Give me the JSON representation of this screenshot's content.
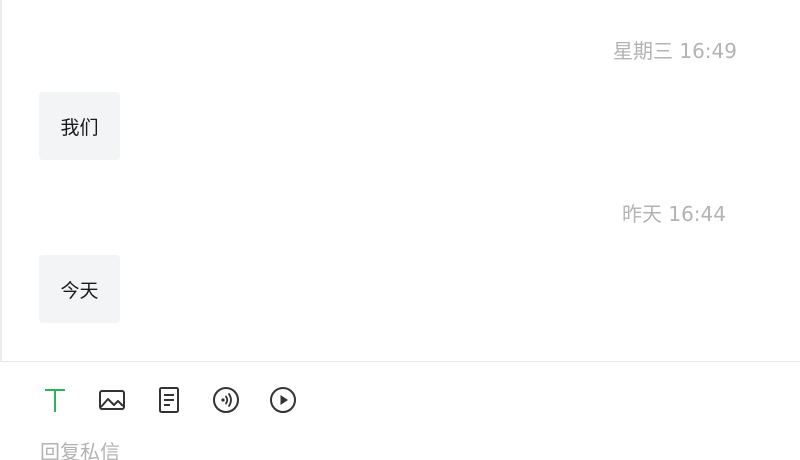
{
  "messages": [
    {
      "timestamp": "星期三 16:49",
      "text": "我们"
    },
    {
      "timestamp": "昨天 16:44",
      "text": "今天"
    }
  ],
  "composer": {
    "placeholder": "回复私信",
    "tools": [
      "text-icon",
      "image-icon",
      "document-icon",
      "audio-icon",
      "video-play-icon"
    ],
    "active_tool_color": "#2eb35a",
    "tool_color": "#333333"
  }
}
